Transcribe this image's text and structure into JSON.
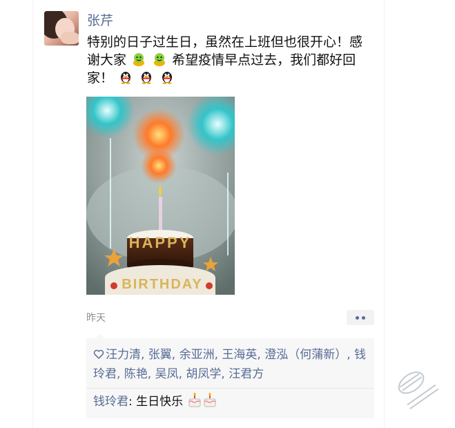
{
  "post": {
    "author": "张芹",
    "text_line1": "特别的日子过生日，虽然在上班但也很开心！感谢大家",
    "text_line2": "希望疫情早点过去，我们都好回家！",
    "time": "昨天"
  },
  "likes": {
    "names": "汪力清, 张翼, 余亚洲, 王海英, 澄泓（何蒲新）, 钱玲君, 陈艳, 吴凤, 胡凤学, 汪君方"
  },
  "comments": [
    {
      "author": "钱玲君",
      "separator": ": ",
      "text": "生日快乐"
    }
  ],
  "photo": {
    "cake_line1": "HAPPY",
    "cake_line2": "BIRTHDAY"
  },
  "colors": {
    "link": "#576b95",
    "text": "#111111",
    "time": "#8f8f8f",
    "comment_bg": "#f7f7f7"
  },
  "icons": {
    "emoji_1": "smile-face-icon",
    "emoji_2": "penguin-icon",
    "like": "heart-icon",
    "comment_emoji": "cake-icon"
  }
}
